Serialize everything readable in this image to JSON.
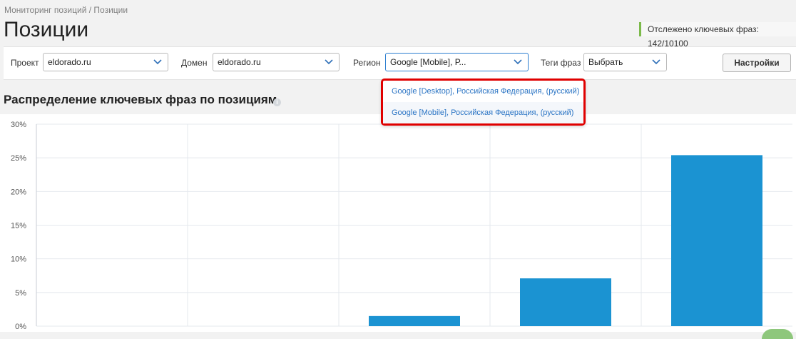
{
  "breadcrumb": "Мониторинг позиций / Позиции",
  "page_title": "Позиции",
  "tracked": "Отслежено ключевых фраз: 142/10100",
  "filters": {
    "project": {
      "label": "Проект",
      "value": "eldorado.ru"
    },
    "domain": {
      "label": "Домен",
      "value": "eldorado.ru"
    },
    "region": {
      "label": "Регион",
      "value": "Google [Mobile], Р..."
    },
    "tags": {
      "label": "Теги фраз",
      "value": "Выбрать"
    },
    "settings_button": "Настройки"
  },
  "region_dropdown": {
    "options": [
      "Google [Desktop], Российская Федерация, (русский)",
      "Google [Mobile], Российская Федерация, (русский)"
    ]
  },
  "section_title": "Распределение ключевых фраз по позициям",
  "colors": {
    "bar": "#1b93d2",
    "highlight_border": "#e00000",
    "accent_green": "#7cba4a"
  },
  "chart_data": {
    "type": "bar",
    "values": [
      0,
      0,
      1.5,
      7.1,
      25.4
    ],
    "ylim": [
      0,
      30
    ],
    "yticks": [
      "0%",
      "5%",
      "10%",
      "15%",
      "20%",
      "25%",
      "30%"
    ],
    "grid": true
  }
}
